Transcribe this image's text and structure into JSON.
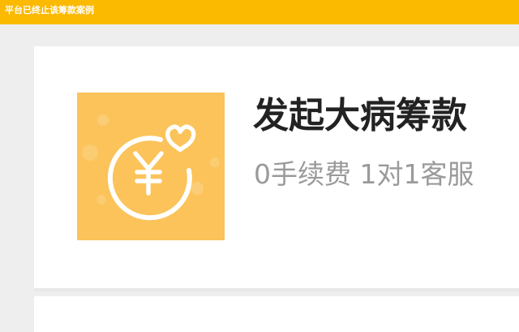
{
  "banner": {
    "text": "平台已终止该筹款案例"
  },
  "card": {
    "title": "发起大病筹款",
    "subtitle": "0手续费 1对1客服",
    "icon": "yuan-heart-icon"
  },
  "colors": {
    "banner_bg": "#fbb900",
    "icon_tile_bg": "#fbc35a",
    "page_bg": "#eeeeee",
    "title": "#222222",
    "subtitle": "#9a9a9a"
  }
}
